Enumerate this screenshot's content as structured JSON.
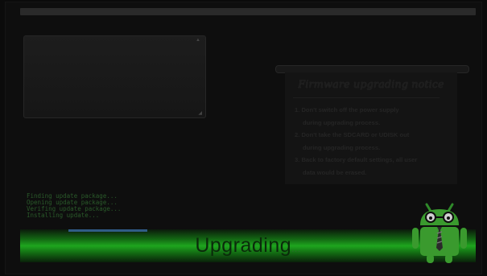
{
  "notice": {
    "title": "Firmware upgrading notice",
    "lines": [
      "1. Don't switch off the power supply",
      "during upgrading  process.",
      "2. Don't take the SDCARD or UDISK out",
      "during upgrading  process.",
      "3. Back to factory default settings, all user",
      "data would be erased."
    ]
  },
  "status_log": [
    "Finding update package...",
    "Opening update package...",
    "Verifing update package...",
    "Installing update..."
  ],
  "progress": {
    "label": "Upgrading",
    "dots": "..."
  },
  "colors": {
    "background": "#0b0b0b",
    "progress_green": "#1ea51e",
    "log_text": "#2a5a2a"
  },
  "icons": {
    "mascot": "android-robot-icon"
  }
}
